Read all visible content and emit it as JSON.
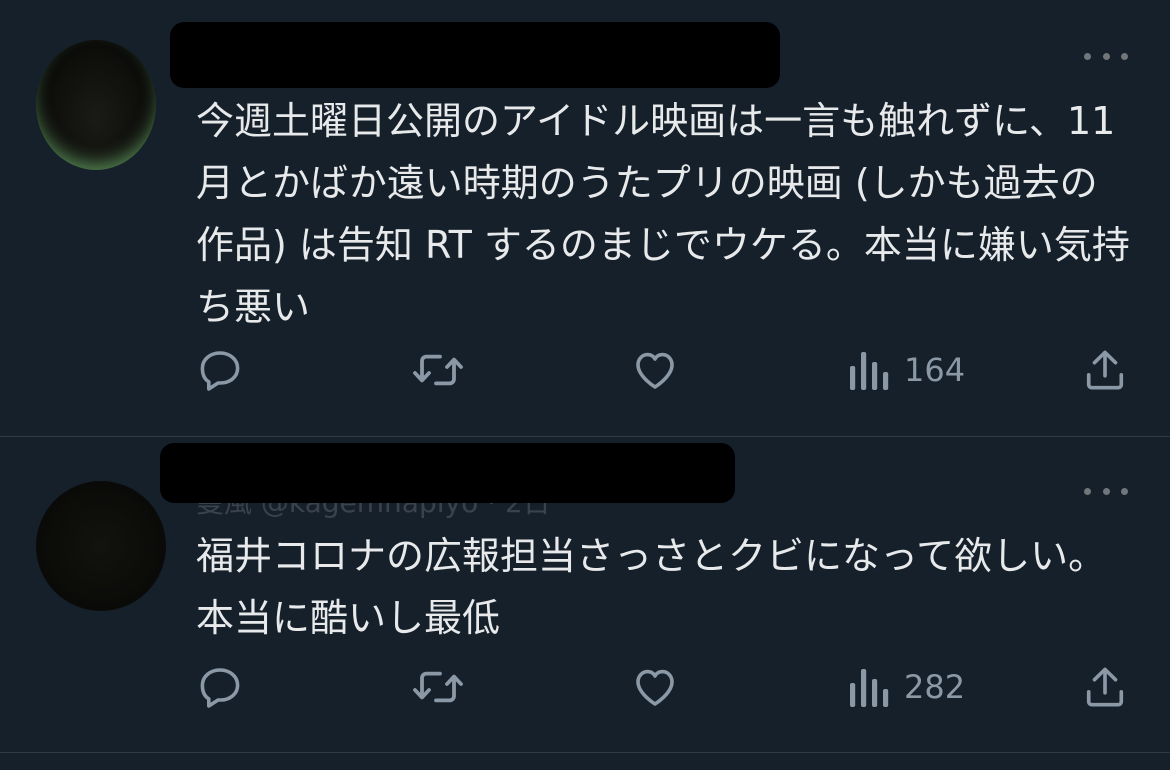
{
  "tweets": [
    {
      "text": "今週土曜日公開のアイドル映画は一言も触れずに、11月とかばか遠い時期のうたプリの映画 (しかも過去の作品) は告知 RT するのまじでウケる。本当に嫌い気持ち悪い",
      "views": "164"
    },
    {
      "header_ghost": "曼風 @kagemnapiyo · 2日",
      "text": "福井コロナの広報担当さっさとクビになって欲しい。本当に酷いし最低",
      "views": "282"
    }
  ],
  "icons": {
    "reply": "reply-icon",
    "retweet": "retweet-icon",
    "like": "heart-icon",
    "views": "views-icon",
    "share": "share-icon",
    "more": "more-icon"
  },
  "colors": {
    "background": "#15202b",
    "text": "#e7e9ea",
    "icon": "#8b98a5",
    "divider": "#2f3a45"
  }
}
